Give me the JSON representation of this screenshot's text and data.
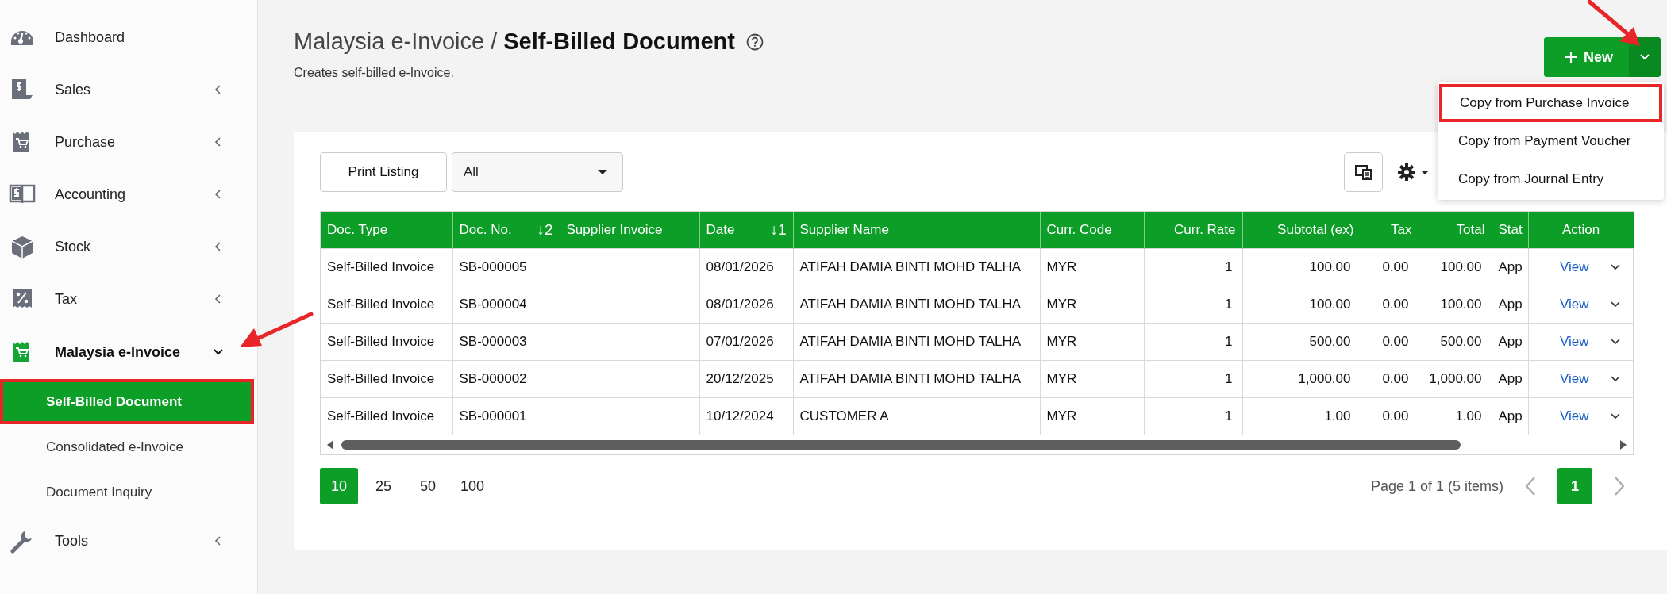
{
  "sidebar": {
    "items": [
      {
        "label": "Dashboard",
        "kind": "link"
      },
      {
        "label": "Sales",
        "kind": "group",
        "expanded": false
      },
      {
        "label": "Purchase",
        "kind": "group",
        "expanded": false
      },
      {
        "label": "Accounting",
        "kind": "group",
        "expanded": false
      },
      {
        "label": "Stock",
        "kind": "group",
        "expanded": false
      },
      {
        "label": "Tax",
        "kind": "group",
        "expanded": false
      },
      {
        "label": "Malaysia e-Invoice",
        "kind": "group",
        "expanded": true,
        "children": [
          {
            "label": "Self-Billed Document",
            "selected": true,
            "highlighted": true
          },
          {
            "label": "Consolidated e-Invoice",
            "selected": false,
            "highlighted": false
          },
          {
            "label": "Document Inquiry",
            "selected": false,
            "highlighted": false
          }
        ]
      },
      {
        "label": "Tools",
        "kind": "group",
        "expanded": false
      }
    ]
  },
  "header": {
    "breadcrumb_parent": "Malaysia e-Invoice /",
    "title": "Self-Billed Document",
    "subtitle": "Creates self-billed e-Invoice."
  },
  "new_button": {
    "label": "New",
    "menu_open": true,
    "menu": [
      {
        "label": "Copy from Purchase Invoice",
        "highlighted": true
      },
      {
        "label": "Copy from Payment Voucher",
        "highlighted": false
      },
      {
        "label": "Copy from Journal Entry",
        "highlighted": false
      }
    ]
  },
  "toolbar": {
    "print_button": "Print Listing",
    "filter": {
      "value": "All"
    }
  },
  "table": {
    "columns": [
      {
        "label": "Doc. Type"
      },
      {
        "label": "Doc. No.",
        "sort": "↓2"
      },
      {
        "label": "Supplier Invoice"
      },
      {
        "label": "Date",
        "sort": "↓1"
      },
      {
        "label": "Supplier Name"
      },
      {
        "label": "Curr. Code"
      },
      {
        "label": "Curr. Rate"
      },
      {
        "label": "Subtotal (ex)"
      },
      {
        "label": "Tax"
      },
      {
        "label": "Total"
      },
      {
        "label": "Stat"
      },
      {
        "label": "Action"
      }
    ],
    "rows": [
      {
        "cells": [
          "Self-Billed Invoice",
          "SB-000005",
          "",
          "08/01/2026",
          "ATIFAH DAMIA BINTI MOHD TALHA",
          "MYR",
          "1",
          "100.00",
          "0.00",
          "100.00",
          "App"
        ],
        "action": "View"
      },
      {
        "cells": [
          "Self-Billed Invoice",
          "SB-000004",
          "",
          "08/01/2026",
          "ATIFAH DAMIA BINTI MOHD TALHA",
          "MYR",
          "1",
          "100.00",
          "0.00",
          "100.00",
          "App"
        ],
        "action": "View"
      },
      {
        "cells": [
          "Self-Billed Invoice",
          "SB-000003",
          "",
          "07/01/2026",
          "ATIFAH DAMIA BINTI MOHD TALHA",
          "MYR",
          "1",
          "500.00",
          "0.00",
          "500.00",
          "App"
        ],
        "action": "View"
      },
      {
        "cells": [
          "Self-Billed Invoice",
          "SB-000002",
          "",
          "20/12/2025",
          "ATIFAH DAMIA BINTI MOHD TALHA",
          "MYR",
          "1",
          "1,000.00",
          "0.00",
          "1,000.00",
          "App"
        ],
        "action": "View"
      },
      {
        "cells": [
          "Self-Billed Invoice",
          "SB-000001",
          "",
          "10/12/2024",
          "CUSTOMER A",
          "MYR",
          "1",
          "1.00",
          "0.00",
          "1.00",
          "App"
        ],
        "action": "View"
      }
    ]
  },
  "pagination": {
    "page_sizes": [
      {
        "label": "10",
        "selected": true
      },
      {
        "label": "25",
        "selected": false
      },
      {
        "label": "50",
        "selected": false
      },
      {
        "label": "100",
        "selected": false
      }
    ],
    "summary": "Page 1 of 1 (5 items)",
    "pages": [
      {
        "label": "1",
        "selected": true
      }
    ]
  }
}
